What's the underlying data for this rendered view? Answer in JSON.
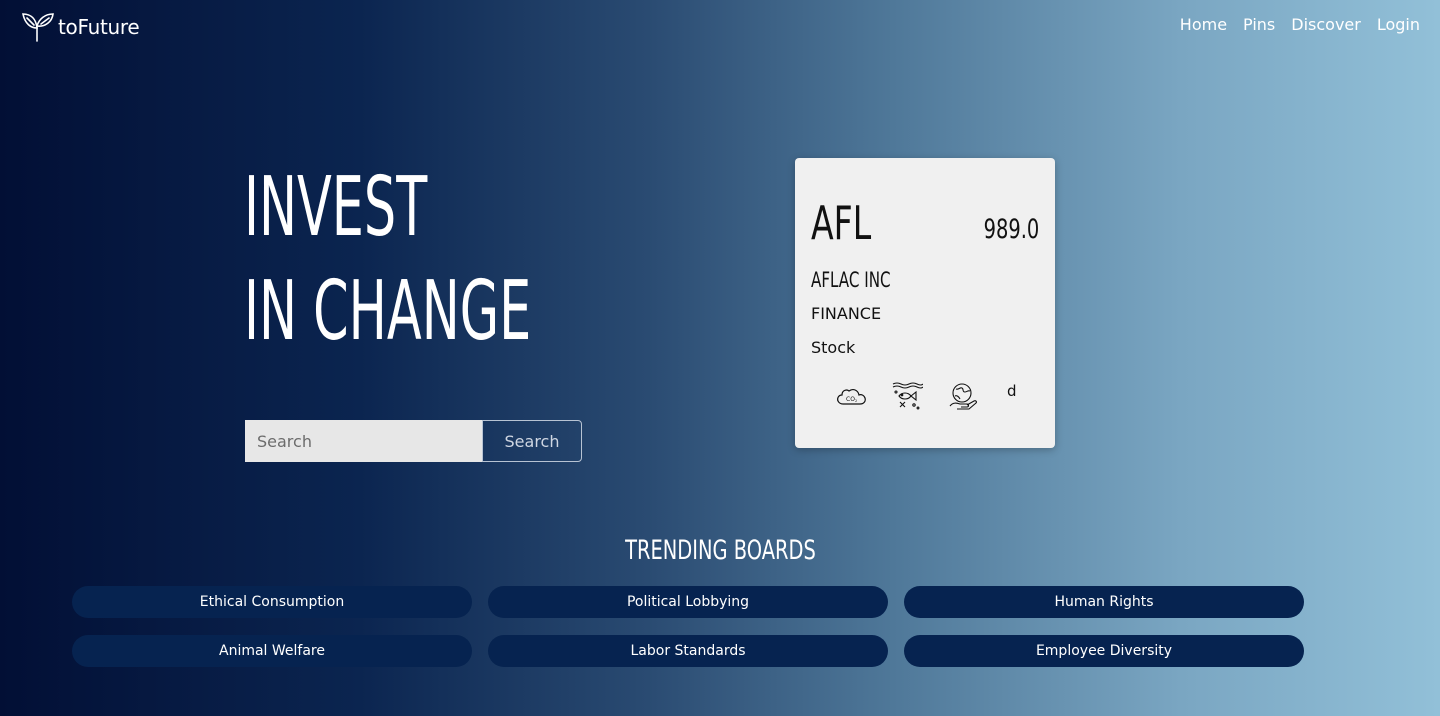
{
  "brand": {
    "name": "toFuture",
    "icon": "sprout-icon"
  },
  "nav": {
    "items": [
      "Home",
      "Pins",
      "Discover",
      "Login"
    ]
  },
  "hero": {
    "line1": "INVEST",
    "line2": "IN CHANGE"
  },
  "search": {
    "placeholder": "Search",
    "button_label": "Search"
  },
  "card": {
    "ticker": "AFL",
    "price": "989.0",
    "company": "AFLAC INC",
    "sector": "FINANCE",
    "asset_type": "Stock",
    "icons": [
      "co2-cloud-icon",
      "ocean-fish-icon",
      "earth-hand-icon"
    ],
    "trailing_text": "d"
  },
  "trending": {
    "heading": "TRENDING BOARDS",
    "boards": [
      "Ethical Consumption",
      "Political Lobbying",
      "Human Rights",
      "Animal Welfare",
      "Labor Standards",
      "Employee Diversity"
    ]
  },
  "colors": {
    "board_bg": "#062350",
    "card_bg": "#f0f0f0",
    "gradient_left": "#020f35",
    "gradient_right": "#92c0d8"
  }
}
